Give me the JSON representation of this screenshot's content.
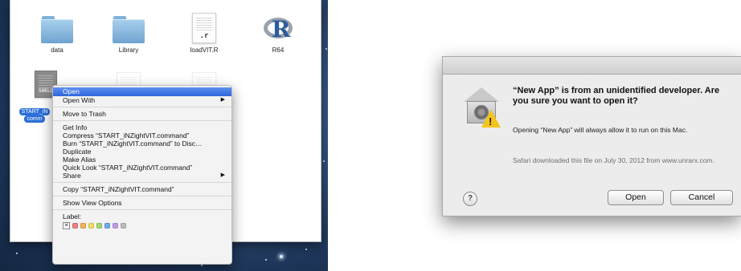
{
  "finder": {
    "files": [
      {
        "label": "data",
        "icon": "folder-icon"
      },
      {
        "label": "Library",
        "icon": "folder-icon"
      },
      {
        "label": "loadVIT.R",
        "icon": "r-script-icon",
        "ext": ".r"
      },
      {
        "label": "R64",
        "icon": "r-app-icon",
        "glyph": "R"
      }
    ],
    "selected_file": {
      "name_line1": "START_iN",
      "name_line2": "comm",
      "icon_text": "SHELL"
    }
  },
  "context_menu": {
    "open": "Open",
    "open_with": "Open With",
    "move_to_trash": "Move to Trash",
    "get_info": "Get Info",
    "compress": "Compress “START_iNZightVIT.command”",
    "burn": "Burn “START_iNZightVIT.command” to Disc…",
    "duplicate": "Duplicate",
    "make_alias": "Make Alias",
    "quick_look": "Quick Look “START_iNZightVIT.command”",
    "share": "Share",
    "copy": "Copy “START_iNZightVIT.command”",
    "show_view_options": "Show View Options",
    "label": "Label:",
    "label_none_glyph": "✕",
    "submenu_arrow": "▶",
    "label_colors": [
      "#f08080",
      "#f5b15b",
      "#f2de5a",
      "#a3d96b",
      "#6fa8ee",
      "#c39ae6",
      "#bdbdbd"
    ]
  },
  "dialog": {
    "title": "“New App” is from an unidentified developer. Are you sure you want to open it?",
    "message": "Opening “New App” will always allow it to run on this Mac.",
    "source": "Safari downloaded this file on July 30, 2012 from www.unrarx.com.",
    "help_label": "?",
    "open_button": "Open",
    "cancel_button": "Cancel",
    "warning_glyph": "!",
    "icon": "security-warning-icon"
  }
}
